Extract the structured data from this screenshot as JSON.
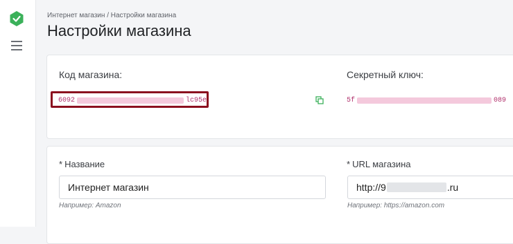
{
  "breadcrumb": {
    "root": "Интернет магазин",
    "separator": "/",
    "current": "Настройки магазина"
  },
  "page_title": "Настройки магазина",
  "keys": {
    "shop_code_label": "Код магазина:",
    "shop_code_start": "6092",
    "shop_code_end": "lc95e",
    "secret_key_label": "Секретный ключ:",
    "secret_key_start": "5f",
    "secret_key_end": "089"
  },
  "form": {
    "name_required_mark": "*",
    "name_label": "Название",
    "name_value": "Интернет магазин",
    "name_hint": "Например: Amazon",
    "url_required_mark": "*",
    "url_label": "URL магазина",
    "url_value_start": "http://9",
    "url_value_end": ".ru",
    "url_hint": "Например: https://amazon.com"
  },
  "icons": {
    "logo": "shield-check-icon",
    "menu": "hamburger-menu-icon",
    "copy": "copy-icon"
  },
  "colors": {
    "brand": "#3bb15a",
    "key_text": "#b0306b",
    "highlight_border": "#8b0f1f"
  }
}
